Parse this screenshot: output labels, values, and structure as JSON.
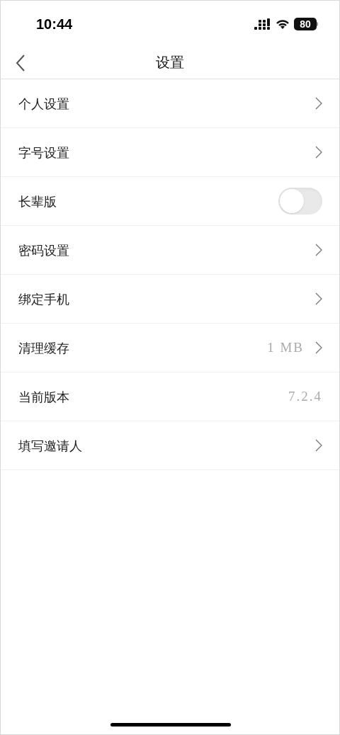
{
  "status_bar": {
    "time": "10:44",
    "battery": "80"
  },
  "nav": {
    "title": "设置"
  },
  "rows": [
    {
      "kind": "link",
      "label": "个人设置"
    },
    {
      "kind": "link",
      "label": "字号设置"
    },
    {
      "kind": "toggle",
      "label": "长辈版",
      "on": false
    },
    {
      "kind": "link",
      "label": "密码设置"
    },
    {
      "kind": "link",
      "label": "绑定手机"
    },
    {
      "kind": "link",
      "label": "清理缓存",
      "value": "1 MB"
    },
    {
      "kind": "info",
      "label": "当前版本",
      "value": "7.2.4"
    },
    {
      "kind": "link",
      "label": "填写邀请人"
    }
  ]
}
